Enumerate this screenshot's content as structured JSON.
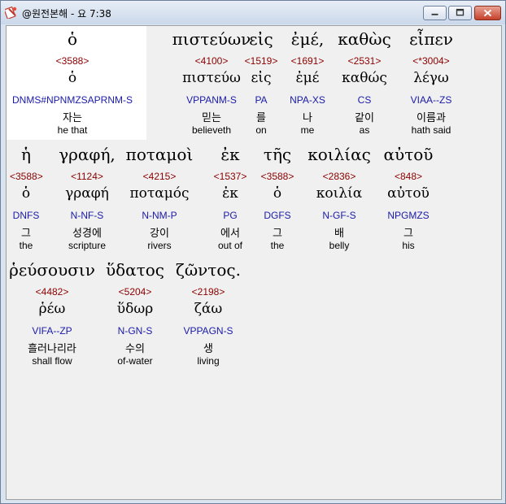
{
  "window": {
    "title": "@원전본해 - 요 7:38",
    "app_icon": "bible-app-icon",
    "buttons": {
      "minimize": "minimize-icon",
      "maximize": "maximize-icon",
      "close": "close-icon"
    }
  },
  "highlight_color": "#ffffff",
  "colors": {
    "strong_number": "#8b0000",
    "parsing": "#1a1aa8"
  },
  "rows": [
    {
      "words": [
        {
          "greek": "ὁ",
          "strong": "<3588>",
          "lemma": "ὁ",
          "parse": "DNMS#NPNMZSAPRNM-S",
          "korean": "자는",
          "english": "he that"
        },
        {
          "greek": "πιστεύων",
          "strong": "<4100>",
          "lemma": "πιστεύω",
          "parse": "VPPANM-S",
          "korean": "믿는",
          "english": "believeth"
        },
        {
          "greek": "εἰς",
          "strong": "<1519>",
          "lemma": "εἰς",
          "parse": "PA",
          "korean": "를",
          "english": "on"
        },
        {
          "greek": "ἐμέ,",
          "strong": "<1691>",
          "lemma": "ἐμέ",
          "parse": "NPA-XS",
          "korean": "나",
          "english": "me"
        },
        {
          "greek": "καθὼς",
          "strong": "<2531>",
          "lemma": "καθώς",
          "parse": "CS",
          "korean": "같이",
          "english": "as"
        },
        {
          "greek": "εἶπεν",
          "strong": "<*3004>",
          "lemma": "λέγω",
          "parse": "VIAA--ZS",
          "korean": "이름과",
          "english": "hath said"
        }
      ]
    },
    {
      "words": [
        {
          "greek": "ἡ",
          "strong": "<3588>",
          "lemma": "ὁ",
          "parse": "DNFS",
          "korean": "그",
          "english": "the"
        },
        {
          "greek": "γραφή,",
          "strong": "<1124>",
          "lemma": "γραφή",
          "parse": "N-NF-S",
          "korean": "성경에",
          "english": "scripture"
        },
        {
          "greek": "ποταμοὶ",
          "strong": "<4215>",
          "lemma": "ποταμός",
          "parse": "N-NM-P",
          "korean": "강이",
          "english": "rivers"
        },
        {
          "greek": "ἐκ",
          "strong": "<1537>",
          "lemma": "ἐκ",
          "parse": "PG",
          "korean": "에서",
          "english": "out of"
        },
        {
          "greek": "τῆς",
          "strong": "<3588>",
          "lemma": "ὁ",
          "parse": "DGFS",
          "korean": "그",
          "english": "the"
        },
        {
          "greek": "κοιλίας",
          "strong": "<2836>",
          "lemma": "κοιλία",
          "parse": "N-GF-S",
          "korean": "배",
          "english": "belly"
        },
        {
          "greek": "αὐτοῦ",
          "strong": "<848>",
          "lemma": "αὐτοῦ",
          "parse": "NPGMZS",
          "korean": "그",
          "english": "his"
        }
      ]
    },
    {
      "words": [
        {
          "greek": "ῥεύσουσιν",
          "strong": "<4482>",
          "lemma": "ῥέω",
          "parse": "VIFA--ZP",
          "korean": "흘러나리라",
          "english": "shall flow"
        },
        {
          "greek": "ὕδατος",
          "strong": "<5204>",
          "lemma": "ὕδωρ",
          "parse": "N-GN-S",
          "korean": "수의",
          "english": "of-water"
        },
        {
          "greek": "ζῶντος.",
          "strong": "<2198>",
          "lemma": "ζάω",
          "parse": "VPPAGN-S",
          "korean": "생",
          "english": "living"
        }
      ]
    }
  ]
}
